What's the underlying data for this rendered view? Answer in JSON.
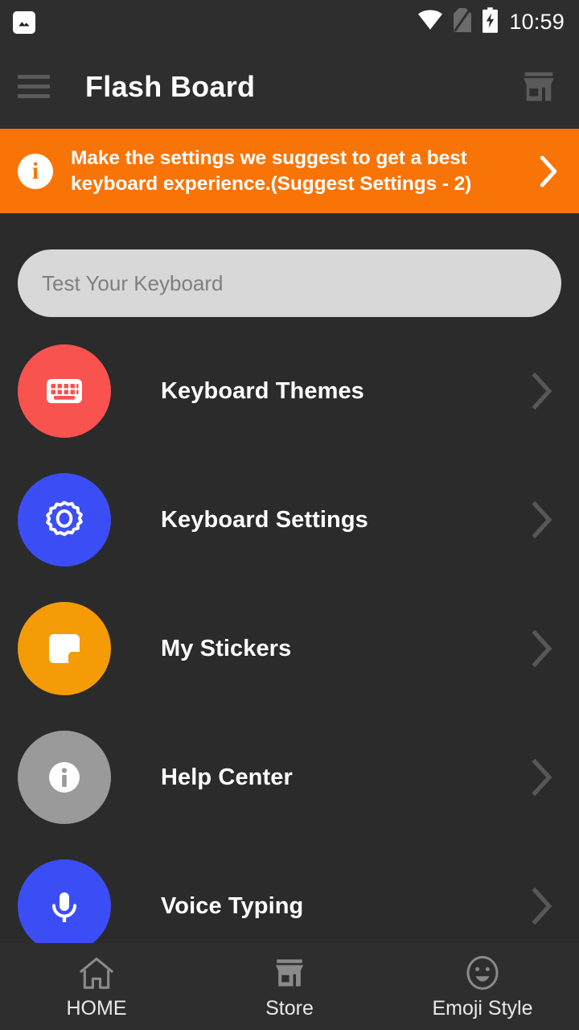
{
  "status_bar": {
    "time": "10:59",
    "left_icons": [
      {
        "name": "screenshot-image-icon"
      }
    ],
    "right_icons": [
      {
        "name": "wifi-icon"
      },
      {
        "name": "sim-card-off-icon"
      },
      {
        "name": "battery-charging-icon"
      }
    ]
  },
  "app_bar": {
    "menu_icon": "hamburger-menu-icon",
    "title": "Flash Board",
    "store_icon": "store-icon"
  },
  "banner": {
    "icon": "info-icon",
    "text": "Make the settings we suggest to get a best keyboard experience.(Suggest Settings - 2)",
    "chevron_icon": "chevron-right-icon",
    "background_color": "#F97407"
  },
  "search": {
    "placeholder": "Test Your Keyboard",
    "value": ""
  },
  "menu_items": [
    {
      "label": "Keyboard Themes",
      "icon": "keyboard-icon",
      "color": "#F9534F",
      "chevron_icon": "chevron-right-icon"
    },
    {
      "label": "Keyboard Settings",
      "icon": "gear-icon",
      "color": "#3B4EF5",
      "chevron_icon": "chevron-right-icon"
    },
    {
      "label": "My Stickers",
      "icon": "sticker-icon",
      "color": "#F59B05",
      "chevron_icon": "chevron-right-icon"
    },
    {
      "label": "Help Center",
      "icon": "info-icon",
      "color": "#9A9A9A",
      "chevron_icon": "chevron-right-icon"
    },
    {
      "label": "Voice Typing",
      "icon": "microphone-icon",
      "color": "#3B4EF5",
      "chevron_icon": "chevron-right-icon"
    }
  ],
  "bottom_nav": [
    {
      "label": "HOME",
      "icon": "home-icon"
    },
    {
      "label": "Store",
      "icon": "store-icon"
    },
    {
      "label": "Emoji Style",
      "icon": "emoji-smiley-icon"
    }
  ]
}
